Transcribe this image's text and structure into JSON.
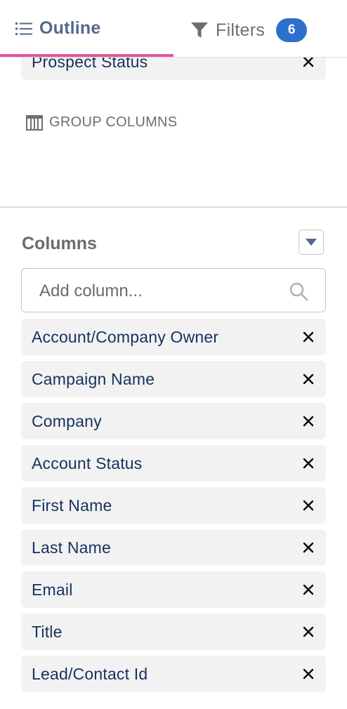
{
  "tabs": {
    "outline_label": "Outline",
    "filters_label": "Filters",
    "filters_count": "6"
  },
  "groups": {
    "partial_item_label": "Prospect Status",
    "group_columns_label": "GROUP COLUMNS"
  },
  "columns": {
    "title": "Columns",
    "search_placeholder": "Add column...",
    "items": [
      {
        "label": "Account/Company Owner"
      },
      {
        "label": "Campaign Name"
      },
      {
        "label": "Company"
      },
      {
        "label": "Account Status"
      },
      {
        "label": "First Name"
      },
      {
        "label": "Last Name"
      },
      {
        "label": "Email"
      },
      {
        "label": "Title"
      },
      {
        "label": "Lead/Contact Id"
      }
    ]
  },
  "colors": {
    "accent_pink": "#e5559a",
    "badge_blue": "#2d6fcd",
    "text_navy": "#16325c",
    "pill_bg": "#f2f2f3"
  },
  "icons": {
    "outline": "list-icon",
    "filters": "funnel-icon",
    "group_columns": "columns-icon",
    "remove": "close-icon",
    "dropdown": "caret-down-icon",
    "search": "search-icon"
  }
}
